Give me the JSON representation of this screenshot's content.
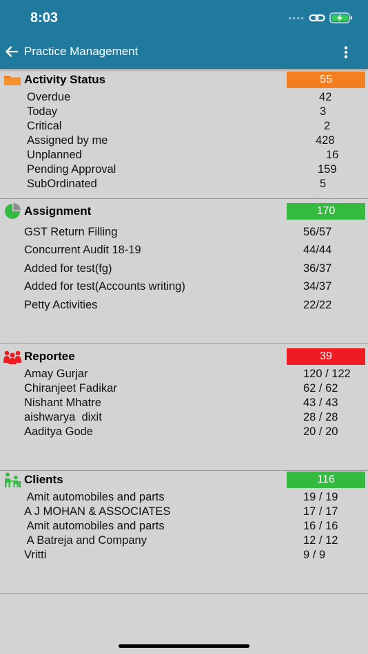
{
  "status_bar": {
    "time": "8:03"
  },
  "app_bar": {
    "title": "Practice Management"
  },
  "colors": {
    "primary": "#1f7a9e",
    "orange": "#f47f20",
    "green": "#33bb3f",
    "red": "#ee1c22",
    "background": "#d3d3d3"
  },
  "sections": [
    {
      "title": "Activity Status",
      "count": "55",
      "icon": "folder-icon",
      "rows": [
        {
          "label": "Overdue",
          "value": "42"
        },
        {
          "label": "Today",
          "value": "3"
        },
        {
          "label": "Critical",
          "value": "2"
        },
        {
          "label": "Assigned by me",
          "value": "428"
        },
        {
          "label": "Unplanned",
          "value": "16"
        },
        {
          "label": "Pending Approval",
          "value": "159"
        },
        {
          "label": "SubOrdinated",
          "value": "5"
        }
      ]
    },
    {
      "title": "Assignment",
      "count": "170",
      "icon": "pie-chart-icon",
      "rows": [
        {
          "label": "GST Return Filling",
          "value": "56/57"
        },
        {
          "label": "Concurrent Audit 18-19",
          "value": "44/44"
        },
        {
          "label": "Added for test(fg)",
          "value": "36/37"
        },
        {
          "label": "Added for test(Accounts writing)",
          "value": "34/37"
        },
        {
          "label": "Petty Activities",
          "value": "22/22"
        }
      ]
    },
    {
      "title": "Reportee",
      "count": "39",
      "icon": "people-icon",
      "rows": [
        {
          "label": "Amay Gurjar",
          "value": "120 / 122"
        },
        {
          "label": "Chiranjeet Fadikar",
          "value": "62 / 62"
        },
        {
          "label": "Nishant Mhatre",
          "value": "43 / 43"
        },
        {
          "label": "aishwarya  dixit",
          "value": "28 / 28"
        },
        {
          "label": "Aaditya Gode",
          "value": "20 / 20"
        }
      ]
    },
    {
      "title": "Clients",
      "count": "116",
      "icon": "clients-icon",
      "rows": [
        {
          "label": " Amit automobiles and parts",
          "value": "19 / 19"
        },
        {
          "label": "A J MOHAN & ASSOCIATES",
          "value": "17 / 17"
        },
        {
          "label": " Amit automobiles and parts",
          "value": "16 / 16"
        },
        {
          "label": " A Batreja and Company",
          "value": "12 / 12"
        },
        {
          "label": "Vritti",
          "value": "9 / 9"
        }
      ]
    }
  ]
}
